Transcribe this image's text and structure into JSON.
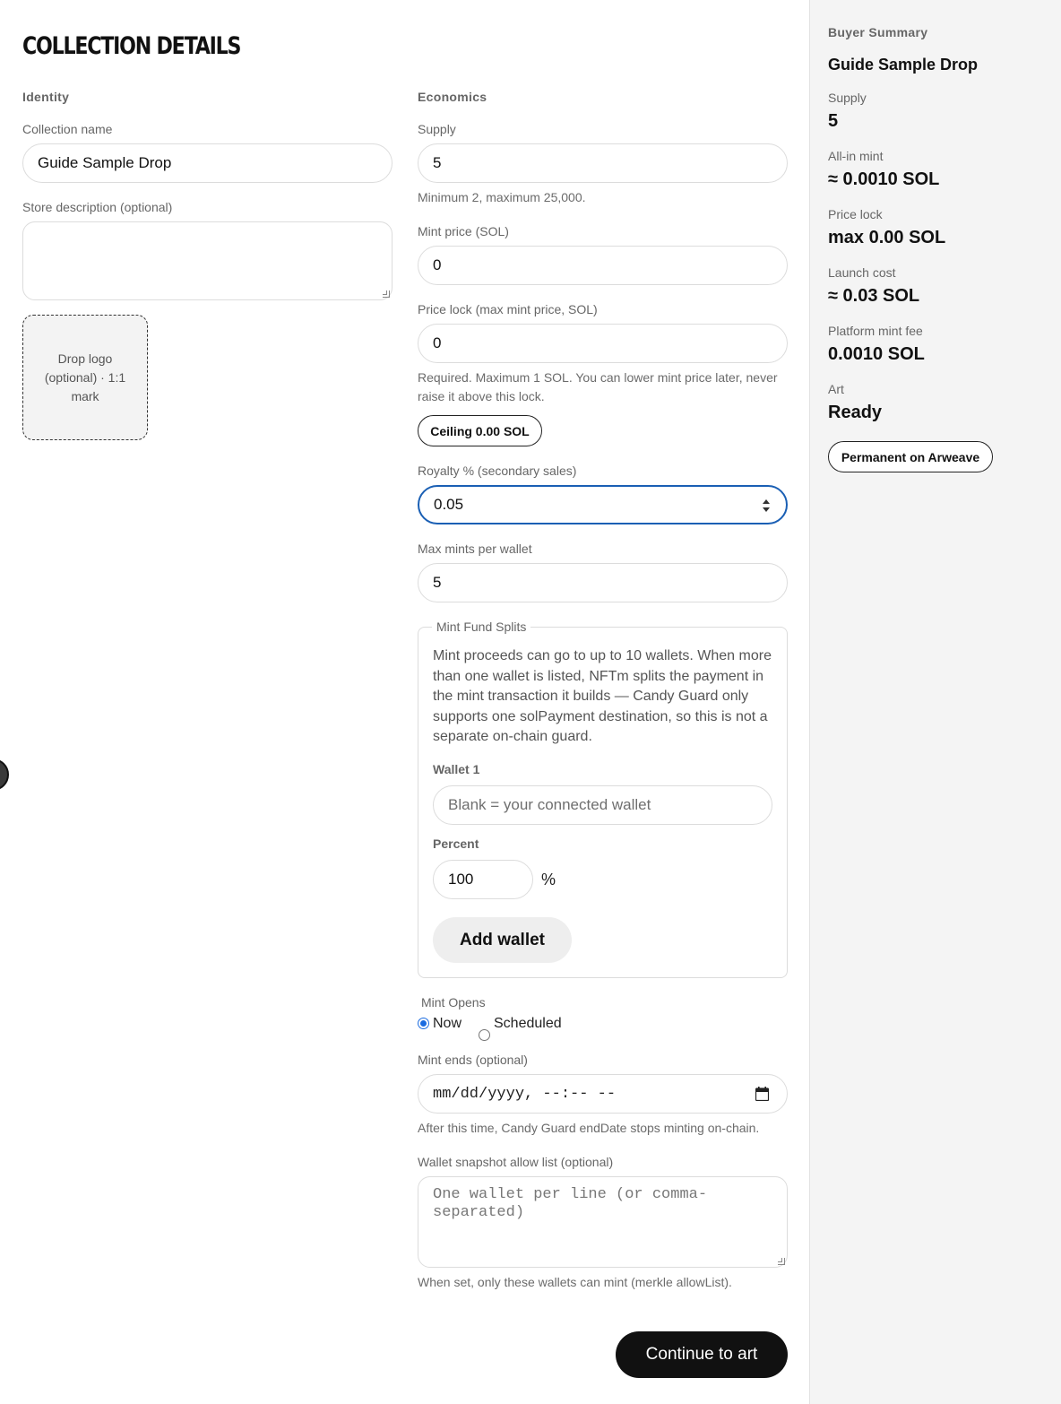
{
  "page": {
    "title": "COLLECTION DETAILS"
  },
  "identity": {
    "section_label": "Identity",
    "name_label": "Collection name",
    "name_value": "Guide Sample Drop",
    "description_label": "Store description (optional)",
    "description_value": "",
    "logo_label": "Drop logo (optional) · 1:1 mark"
  },
  "economics": {
    "section_label": "Economics",
    "supply_label": "Supply",
    "supply_value": "5",
    "supply_help": "Minimum 2, maximum 25,000.",
    "mint_price_label": "Mint price (SOL)",
    "mint_price_value": "0",
    "price_lock_label": "Price lock (max mint price, SOL)",
    "price_lock_value": "0",
    "price_lock_help": "Required. Maximum 1 SOL. You can lower mint price later, never raise it above this lock.",
    "ceiling_pill": "Ceiling 0.00 SOL",
    "royalty_label": "Royalty % (secondary sales)",
    "royalty_value": "0.05",
    "max_mints_label": "Max mints per wallet",
    "max_mints_value": "5"
  },
  "splits": {
    "legend": "Mint Fund Splits",
    "description": "Mint proceeds can go to up to 10 wallets. When more than one wallet is listed, NFTm splits the payment in the mint transaction it builds — Candy Guard only supports one solPayment destination, so this is not a separate on-chain guard.",
    "wallet_label": "Wallet 1",
    "wallet_placeholder": "Blank = your connected wallet",
    "percent_label": "Percent",
    "percent_value": "100",
    "percent_symbol": "%",
    "add_wallet_label": "Add wallet"
  },
  "mint_opens": {
    "label": "Mint Opens",
    "options": [
      "Now",
      "Scheduled"
    ],
    "selected": "Now"
  },
  "mint_ends": {
    "label": "Mint ends (optional)",
    "placeholder": "mm/dd/yyyy, --:-- --",
    "help": "After this time, Candy Guard endDate stops minting on-chain."
  },
  "allow_list": {
    "label": "Wallet snapshot allow list (optional)",
    "placeholder": "One wallet per line (or comma-separated)",
    "help": "When set, only these wallets can mint (merkle allowList)."
  },
  "actions": {
    "continue_label": "Continue to art"
  },
  "summary": {
    "heading": "Buyer Summary",
    "collection_name": "Guide Sample Drop",
    "rows": [
      {
        "label": "Supply",
        "value": "5"
      },
      {
        "label": "All-in mint",
        "value": "≈ 0.0010 SOL"
      },
      {
        "label": "Price lock",
        "value": "max 0.00 SOL"
      },
      {
        "label": "Launch cost",
        "value": "≈ 0.03 SOL"
      },
      {
        "label": "Platform mint fee",
        "value": "0.0010 SOL"
      },
      {
        "label": "Art",
        "value": "Ready"
      }
    ],
    "storage_pill": "Permanent on Arweave"
  },
  "icons": {
    "number_spinner": "spinner-arrows-icon",
    "calendar": "calendar-icon",
    "edge_handle": "edge-handle-icon"
  },
  "colors": {
    "focus": "#1a5fb4",
    "primary_button": "#111111",
    "sidebar_bg": "#f4f4f4",
    "radio_selected": "#1a6be0"
  }
}
